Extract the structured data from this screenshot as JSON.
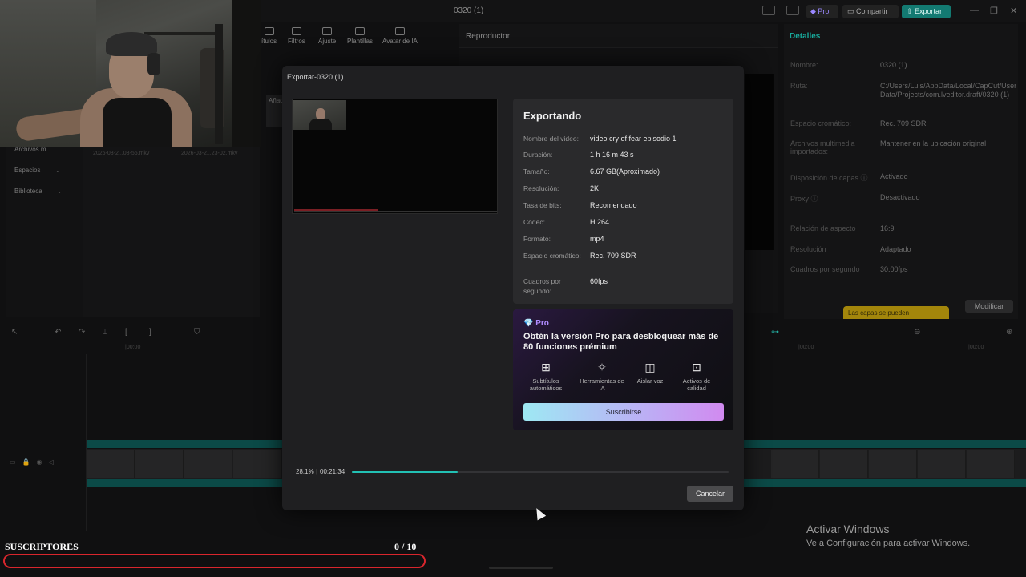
{
  "app": {
    "window_title": "0320 (1)",
    "pro_label": "Pro",
    "share_label": "Compartir",
    "export_label": "Exportar",
    "toolbar_tabs": [
      "ítulos",
      "Filtros",
      "Ajuste",
      "Plantillas",
      "Avatar de IA"
    ],
    "player_title": "Reproductor",
    "left_panel": [
      "Archivos m...",
      "Espacios",
      "Biblioteca"
    ],
    "media_files": [
      "2026-03-2...08-56.mkv",
      "2026-03-2...23-02.mkv"
    ],
    "media_tab": "Añad",
    "details": {
      "title": "Detalles",
      "rows": [
        {
          "k": "Nombre:",
          "v": "0320 (1)"
        },
        {
          "k": "Ruta:",
          "v": "C:/Users/Luis/AppData/Local/CapCut/User Data/Projects/com.lveditor.draft/0320 (1)"
        },
        {
          "k": "Espacio cromático:",
          "v": "Rec. 709 SDR"
        },
        {
          "k": "Archivos multimedia importados:",
          "v": "Mantener en la ubicación original"
        },
        {
          "k": "Disposición de capas ⓘ",
          "v": "Activado"
        },
        {
          "k": "Proxy ⓘ",
          "v": "Desactivado"
        },
        {
          "k": "Relación de aspecto",
          "v": "16:9"
        },
        {
          "k": "Resolución",
          "v": "Adaptado"
        },
        {
          "k": "Cuadros por segundo",
          "v": "30.00fps"
        }
      ],
      "modify_label": "Modificar",
      "tip": "Las capas se pueden"
    },
    "ruler_labels": [
      "|00:00",
      "|00:00",
      "|00:00"
    ]
  },
  "modal": {
    "title": "Exportar-0320 (1)",
    "heading": "Exportando",
    "rows": [
      {
        "k": "Nombre del video:",
        "v": "video cry of fear episodio 1"
      },
      {
        "k": "Duración:",
        "v": "1 h 16 m 43 s"
      },
      {
        "k": "Tamaño:",
        "v": "6.67 GB(Aproximado)"
      },
      {
        "k": "Resolución:",
        "v": "2K"
      },
      {
        "k": "Tasa de bits:",
        "v": "Recomendado"
      },
      {
        "k": "Codec:",
        "v": "H.264"
      },
      {
        "k": "Formato:",
        "v": "mp4"
      },
      {
        "k": "Espacio cromático:",
        "v": "Rec. 709 SDR"
      },
      {
        "k": "Cuadros por segundo:",
        "v": "60fps"
      }
    ],
    "promo": {
      "tag": "💎 Pro",
      "title": "Obtén la versión Pro para desbloquear más de 80 funciones prémium",
      "features": [
        {
          "icon": "subtitles-icon",
          "glyph": "⊞",
          "label": "Subtítulos automáticos"
        },
        {
          "icon": "ai-tools-icon",
          "glyph": "✧",
          "label": "Herramientas de IA"
        },
        {
          "icon": "isolate-voice-icon",
          "glyph": "◫",
          "label": "Aislar voz"
        },
        {
          "icon": "quality-assets-icon",
          "glyph": "⊡",
          "label": "Activos de calidad"
        }
      ],
      "subscribe_label": "Suscribirse"
    },
    "progress": {
      "percent_label": "28.1%",
      "time_label": "00:21:34",
      "value": 0.281
    },
    "cancel_label": "Cancelar"
  },
  "windows_activation": {
    "line1": "Activar Windows",
    "line2": "Ve a Configuración para activar Windows."
  },
  "subscribers": {
    "label": "SUSCRIPTORES",
    "count_label": "0  / 10",
    "value": 0
  },
  "colors": {
    "accent": "#22c1b4",
    "export_button": "#137a72",
    "subs_bar": "#d9262d",
    "pro": "#b08cff"
  }
}
